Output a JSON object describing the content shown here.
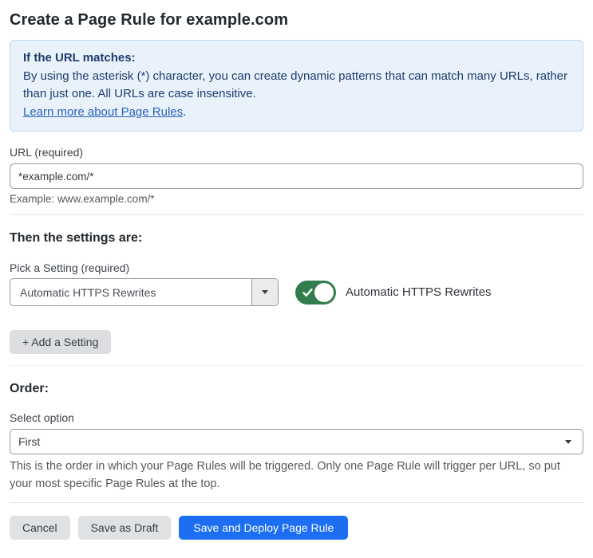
{
  "page": {
    "title": "Create a Page Rule for example.com"
  },
  "banner": {
    "heading": "If the URL matches:",
    "body": "By using the asterisk (*) character, you can create dynamic patterns that can match many URLs, rather than just one. All URLs are case insensitive.",
    "link_label": "Learn more about Page Rules",
    "link_suffix": "."
  },
  "url_field": {
    "label": "URL (required)",
    "value": "*example.com/*",
    "helper": "Example: www.example.com/*"
  },
  "settings": {
    "heading": "Then the settings are:",
    "picker_label": "Pick a Setting (required)",
    "picker_value": "Automatic HTTPS Rewrites",
    "toggle_label": "Automatic HTTPS Rewrites",
    "toggle_state": "on",
    "add_button_label": "+ Add a Setting"
  },
  "order": {
    "heading": "Order:",
    "select_label": "Select option",
    "select_value": "First",
    "helper": "This is the order in which your Page Rules will be triggered. Only one Page Rule will trigger per URL, so put your most specific Page Rules at the top."
  },
  "footer": {
    "cancel_label": "Cancel",
    "save_draft_label": "Save as Draft",
    "save_deploy_label": "Save and Deploy Page Rule"
  },
  "colors": {
    "accent_blue": "#1c6ff2",
    "toggle_green": "#327d4e",
    "banner_bg": "#e9f2fb",
    "banner_border": "#bcd7ef",
    "banner_text": "#1d3c6d",
    "link_blue": "#2a62bd"
  },
  "icons": {
    "picker_caret": "caret-down",
    "select_caret": "caret-down",
    "toggle_check": "check"
  }
}
